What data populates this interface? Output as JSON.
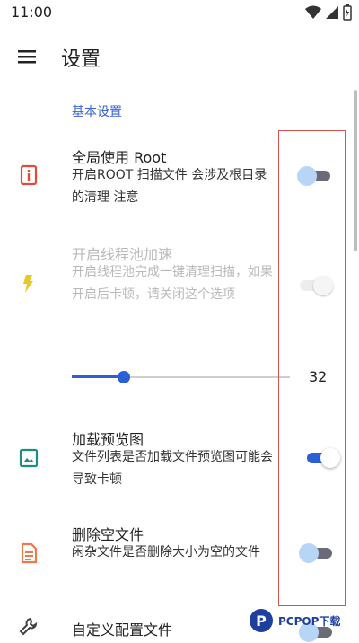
{
  "status_bar": {
    "time": "11:00"
  },
  "app_bar": {
    "title": "设置",
    "menu_icon": "hamburger-menu-icon"
  },
  "section": {
    "header": "基本设置"
  },
  "items": [
    {
      "title": "全局使用 Root",
      "summary": "开启ROOT 扫描文件 会涉及根目录的清理 注意",
      "icon": "info-rect-icon",
      "icon_color": "#e04b3a",
      "switch_state": "off",
      "enabled": true
    },
    {
      "title": "开启线程池加速",
      "summary": "开启线程池完成一键清理扫描，如果开启后卡顿，请关闭这个选项",
      "icon": "lightning-icon",
      "icon_color": "#e9c82a",
      "switch_state": "on",
      "enabled": false
    },
    {
      "title": "加载预览图",
      "summary": "文件列表是否加载文件预览图可能会导致卡顿",
      "icon": "image-icon",
      "icon_color": "#1e8f7e",
      "switch_state": "on",
      "enabled": true
    },
    {
      "title": "删除空文件",
      "summary": "闲杂文件是否删除大小为空的文件",
      "icon": "document-icon",
      "icon_color": "#ea7b4c",
      "switch_state": "off",
      "enabled": true
    },
    {
      "title": "自定义配置文件",
      "icon": "wrench-icon",
      "icon_color": "#404040",
      "switch_state": "off",
      "enabled": true
    }
  ],
  "slider": {
    "value": "32",
    "fraction": 0.24
  },
  "accent_color": "#2a5fd6",
  "watermark": {
    "text": "PCPOP下载"
  }
}
